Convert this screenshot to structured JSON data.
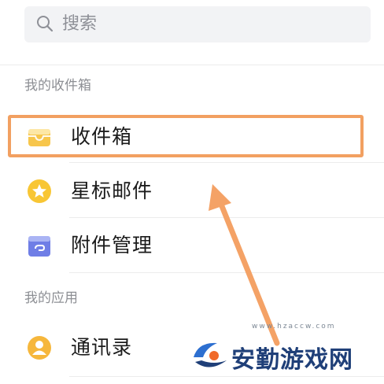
{
  "search": {
    "placeholder": "搜索",
    "icon": "search-icon"
  },
  "sections": {
    "mailbox": {
      "title": "我的收件箱"
    },
    "apps": {
      "title": "我的应用"
    }
  },
  "items": {
    "inbox": {
      "label": "收件箱",
      "icon": "inbox-icon",
      "color": "#f7c64c"
    },
    "starred": {
      "label": "星标邮件",
      "icon": "star-icon",
      "color": "#f8c634"
    },
    "attachments": {
      "label": "附件管理",
      "icon": "attachment-icon",
      "color": "#6f7ee6"
    },
    "contacts": {
      "label": "通讯录",
      "icon": "contacts-icon",
      "color": "#f6b73c"
    }
  },
  "annotation": {
    "highlight_color": "#f2a061",
    "arrow_color": "#f4a266"
  },
  "watermark": {
    "title": "安勤游戏网",
    "url": "www.hzaccw.com"
  }
}
